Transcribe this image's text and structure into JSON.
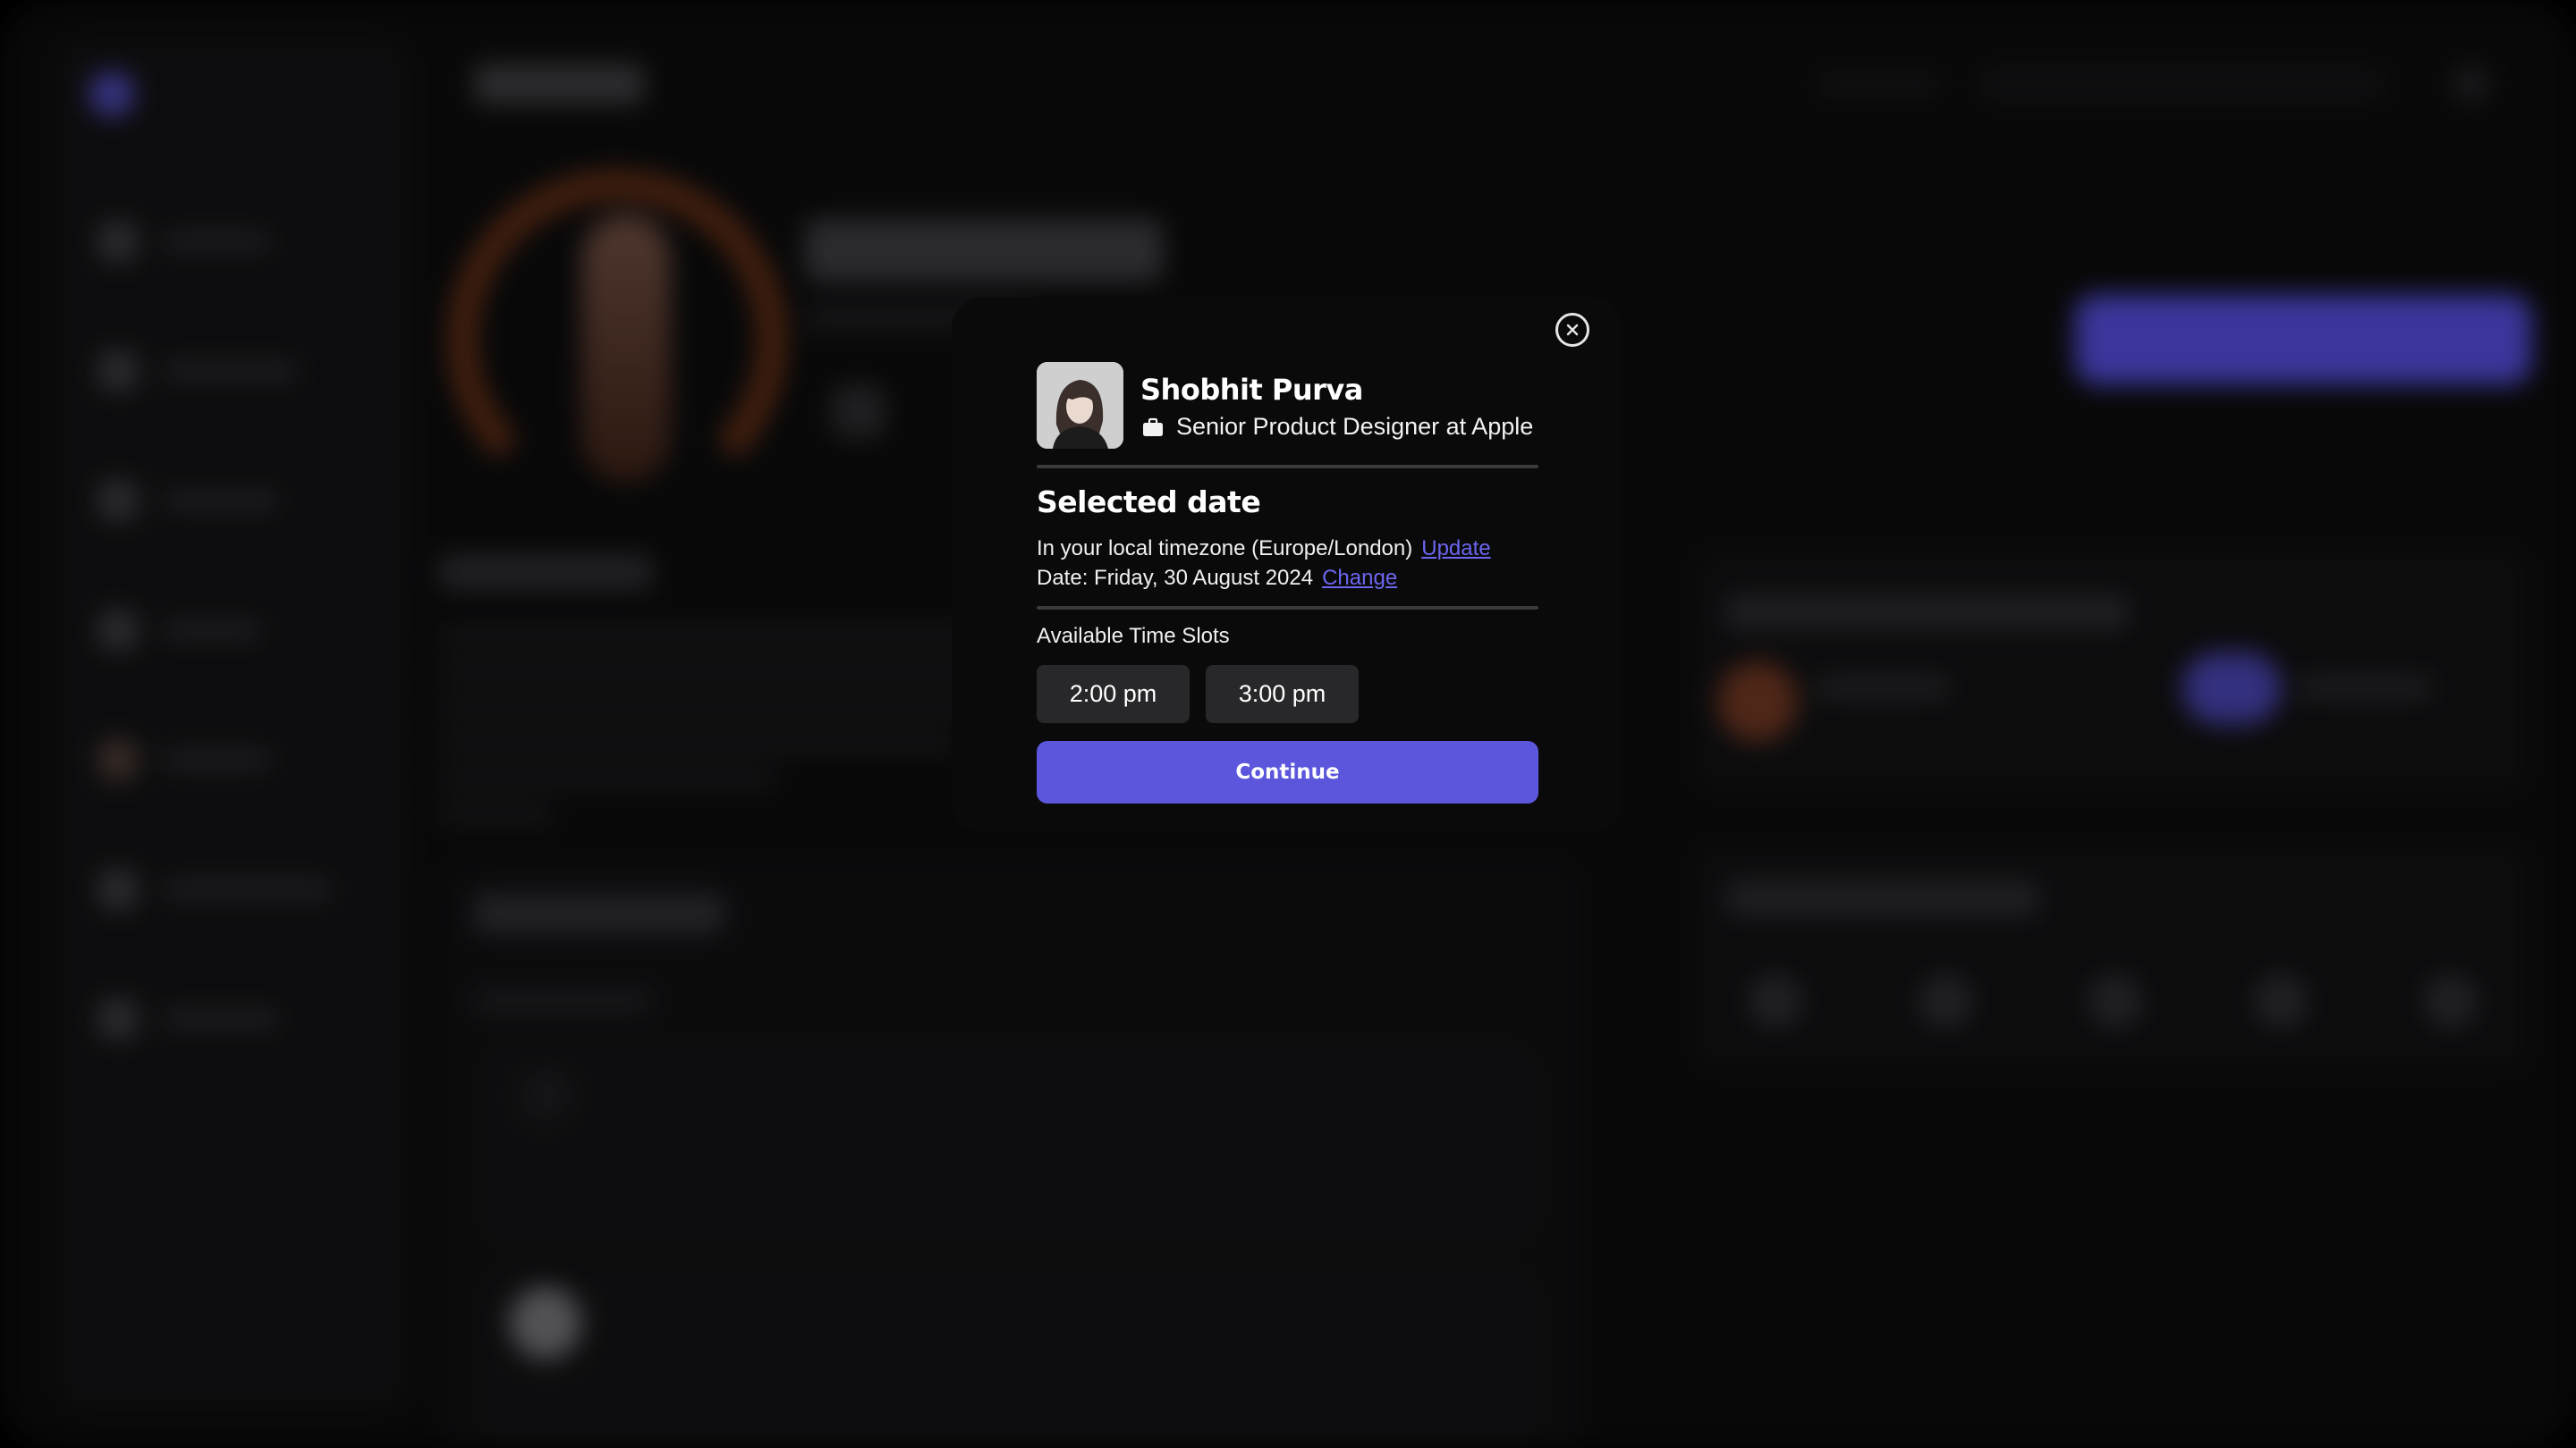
{
  "modal": {
    "profile": {
      "name": "Shobhit Purva",
      "role": "Senior Product Designer at Apple",
      "avatar_icon": "person-photo",
      "role_icon": "briefcase-icon"
    },
    "selected_date": {
      "title": "Selected date",
      "timezone_text": "In your local timezone (Europe/London)",
      "timezone_link": "Update",
      "date_text": "Date: Friday, 30 August 2024",
      "date_link": "Change"
    },
    "time_slots": {
      "label": "Available Time Slots",
      "slots": [
        "2:00 pm",
        "3:00 pm"
      ]
    },
    "continue_label": "Continue",
    "close_icon": "close-icon"
  },
  "colors": {
    "accent": "#5b56dc",
    "link": "#6c66f0",
    "modal_bg": "#0a0a0a",
    "slot_bg": "#28282a"
  }
}
